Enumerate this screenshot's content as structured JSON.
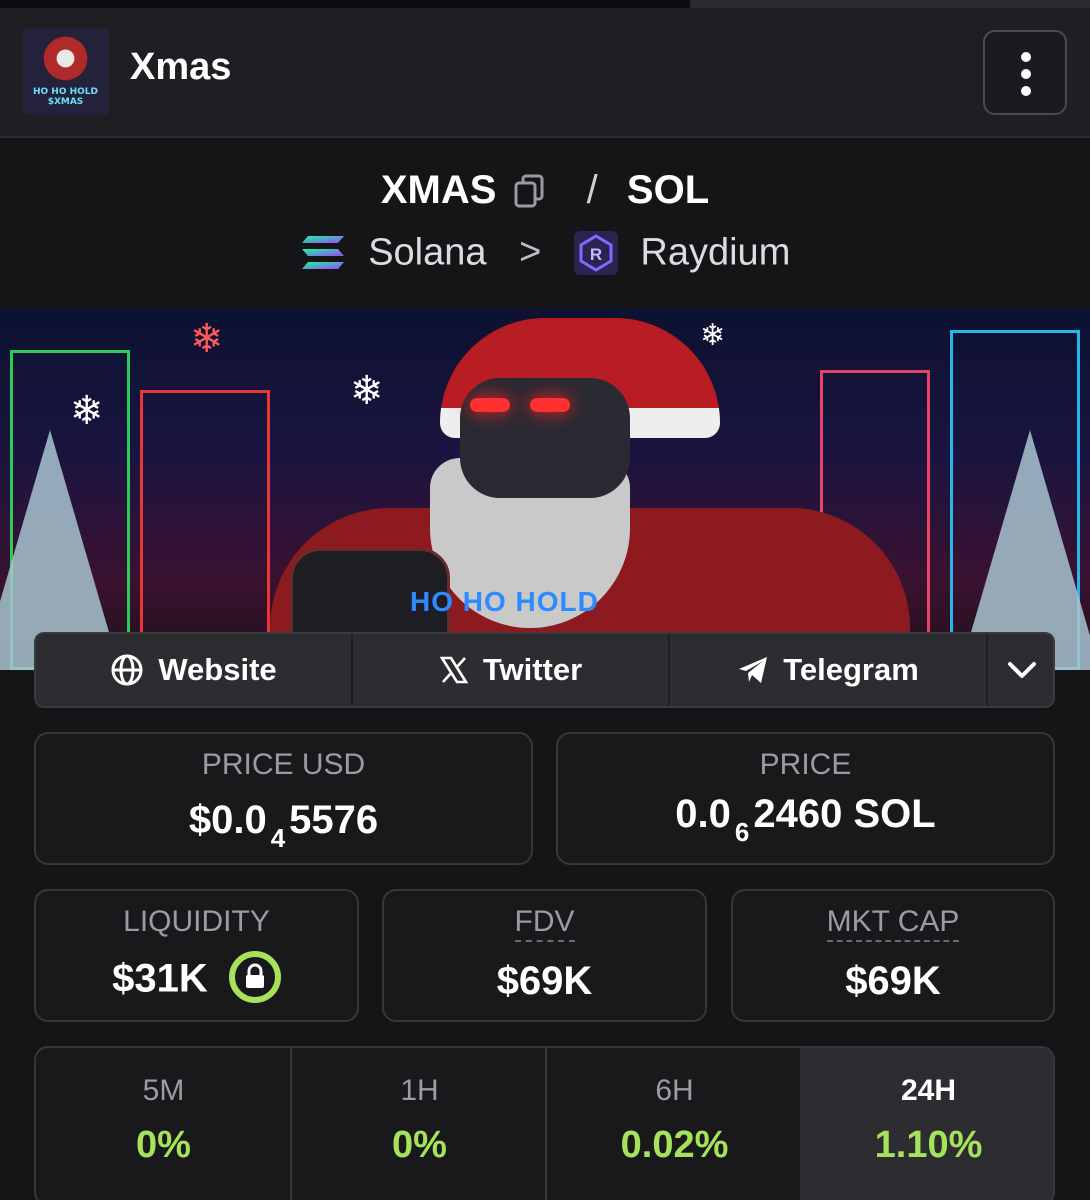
{
  "header": {
    "title": "Xmas",
    "avatar_text": "HO HO HOLD $XMAS",
    "menu_icon": "kebab-menu-icon"
  },
  "pair": {
    "base": "XMAS",
    "separator": "/",
    "quote": "SOL",
    "chain": "Solana",
    "chevron": ">",
    "dex": "Raydium",
    "dex_icon_letter": "R"
  },
  "banner": {
    "caption": "HO HO HOLD"
  },
  "links": {
    "website": "Website",
    "twitter": "Twitter",
    "telegram": "Telegram"
  },
  "price_usd": {
    "label": "PRICE USD",
    "prefix": "$0.0",
    "zeros": "4",
    "digits": "5576"
  },
  "price_native": {
    "label": "PRICE",
    "prefix": "0.0",
    "zeros": "6",
    "digits": "2460 SOL"
  },
  "liquidity": {
    "label": "LIQUIDITY",
    "value": "$31K"
  },
  "fdv": {
    "label": "FDV",
    "value": "$69K"
  },
  "mkt_cap": {
    "label": "MKT CAP",
    "value": "$69K"
  },
  "timeframes": [
    {
      "label": "5M",
      "value": "0%"
    },
    {
      "label": "1H",
      "value": "0%"
    },
    {
      "label": "6H",
      "value": "0.02%"
    },
    {
      "label": "24H",
      "value": "1.10%"
    }
  ],
  "colors": {
    "positive": "#a6e35a",
    "background": "#151518",
    "card_border": "#36363b"
  }
}
